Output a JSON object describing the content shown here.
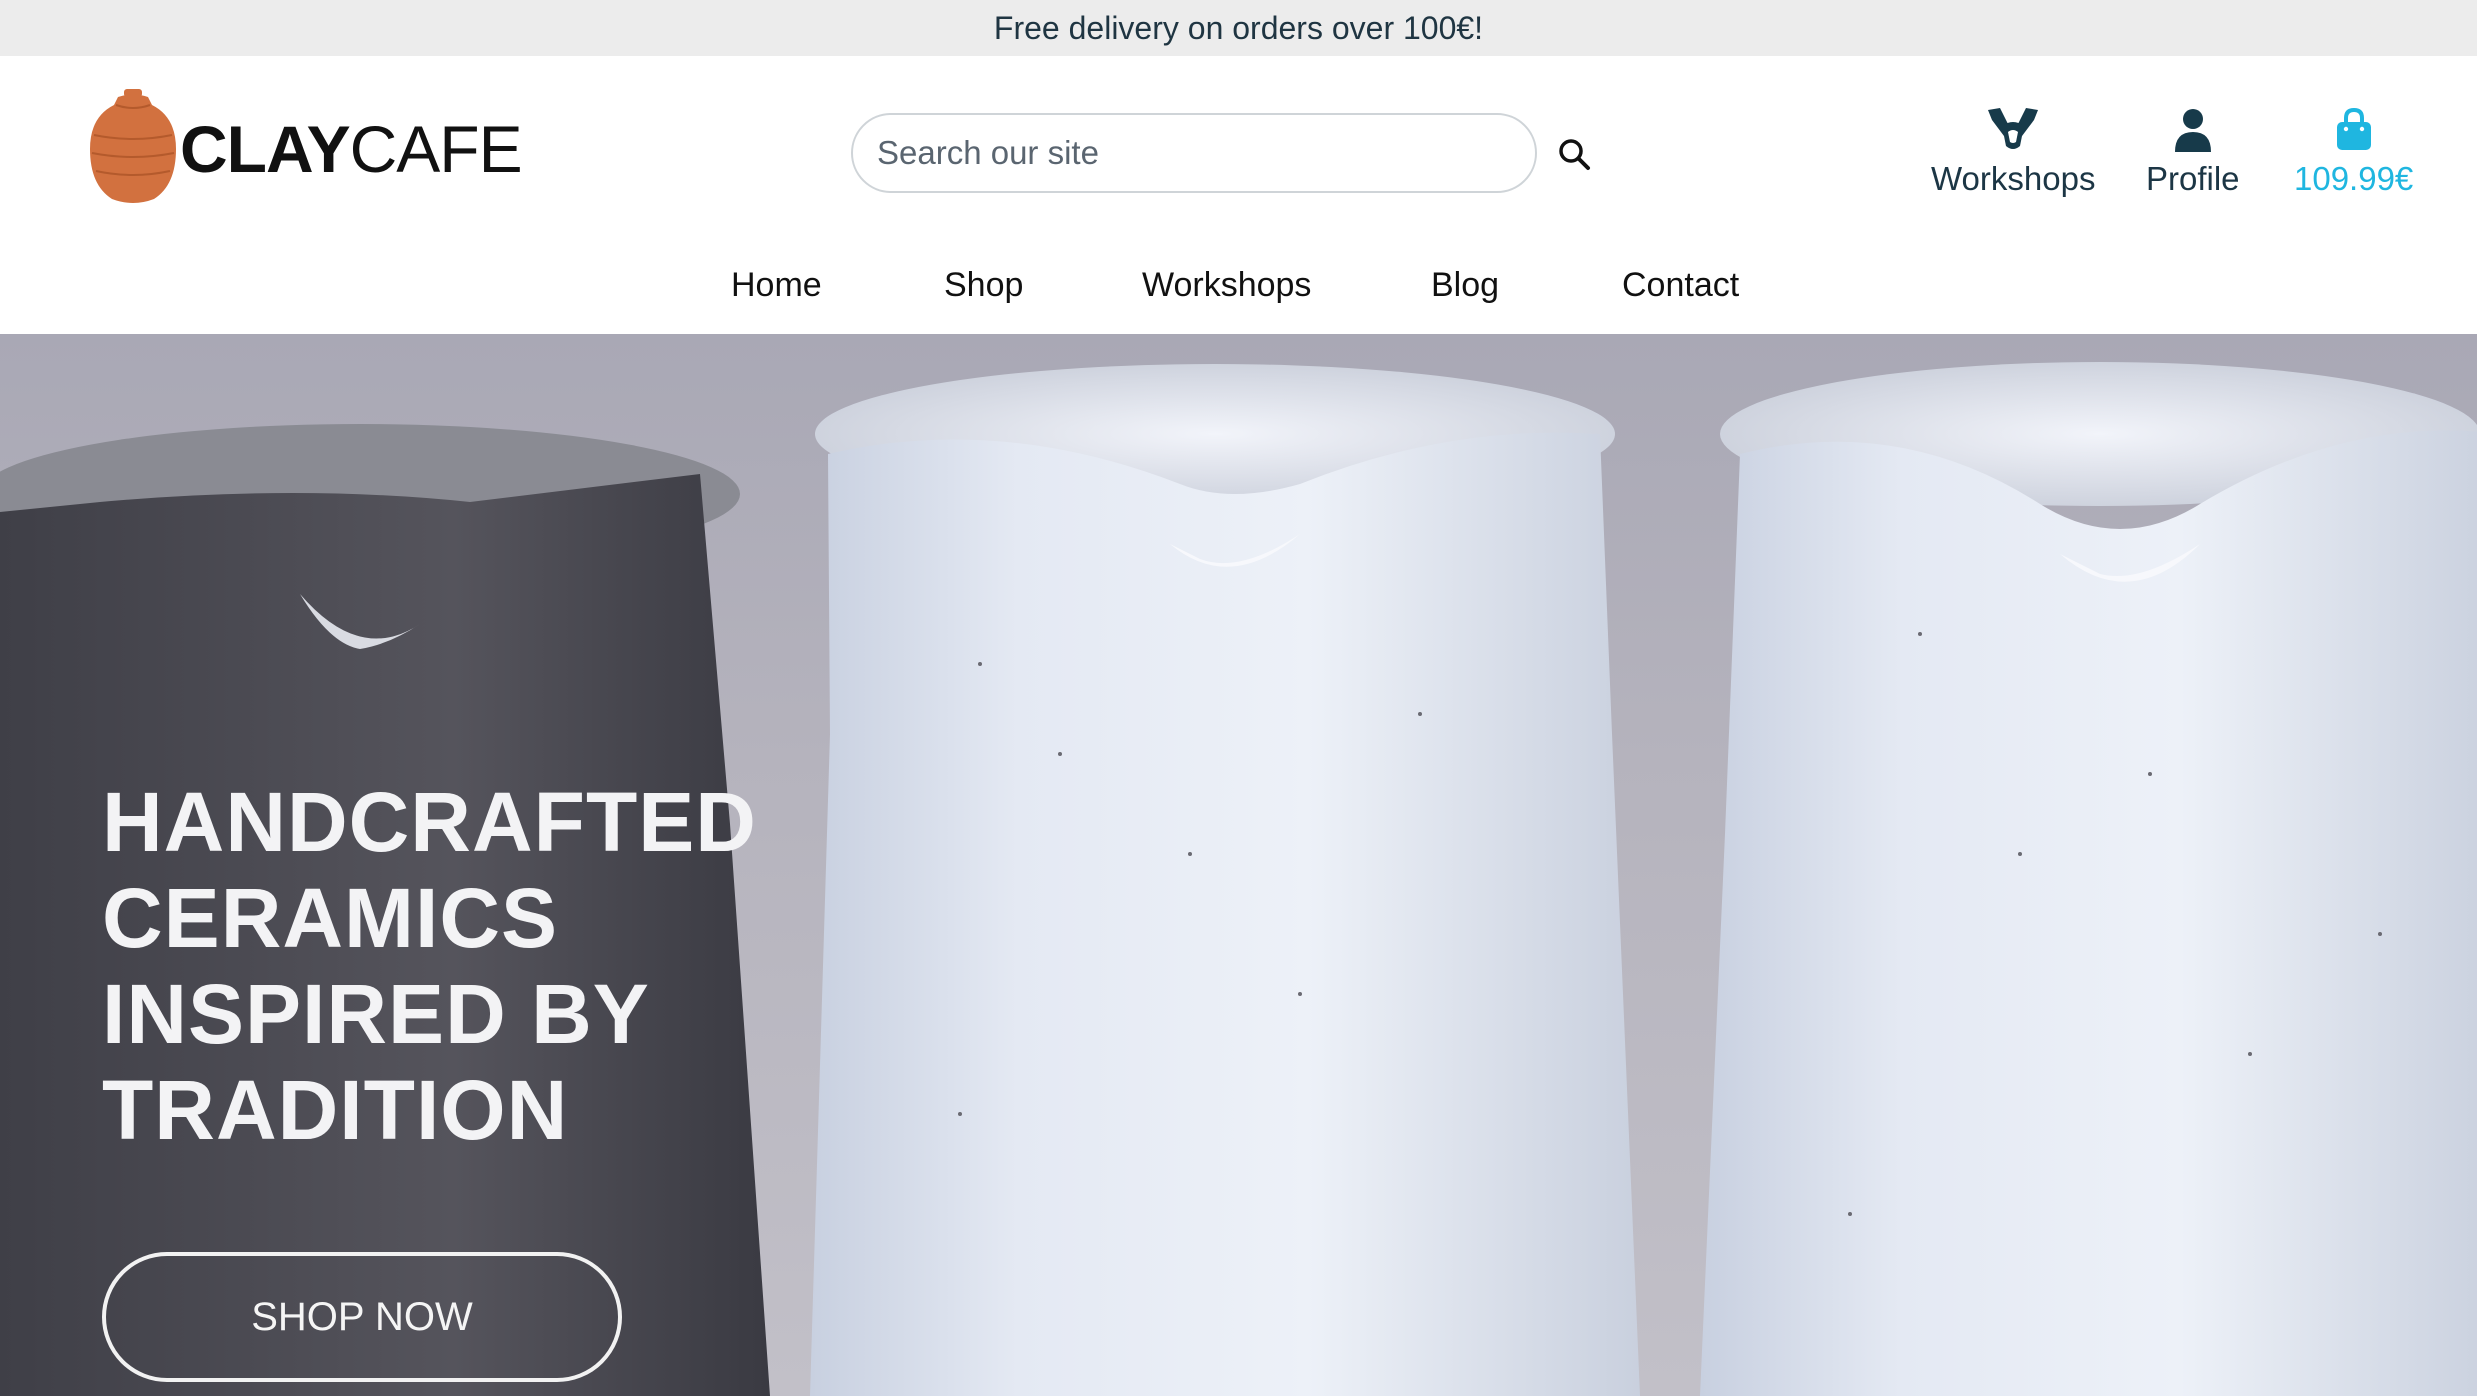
{
  "promo": {
    "text": "Free delivery on orders over 100€!"
  },
  "logo": {
    "part1": "CLAY",
    "part2": "CAFE",
    "icon": "clay-pot-icon",
    "icon_color": "#d2713f"
  },
  "search": {
    "placeholder": "Search our site",
    "value": "",
    "icon": "search-icon"
  },
  "actions": {
    "workshops": {
      "label": "Workshops",
      "icon": "hands-icon"
    },
    "profile": {
      "label": "Profile",
      "icon": "user-icon"
    },
    "cart": {
      "label": "109.99€",
      "icon": "shopping-bag-icon",
      "color": "#1fb6e0"
    }
  },
  "nav": [
    "Home",
    "Shop",
    "Workshops",
    "Blog",
    "Contact"
  ],
  "hero": {
    "title_lines": [
      "HANDCRAFTED",
      "CERAMICS",
      "INSPIRED BY",
      "TRADITION"
    ],
    "cta": "SHOP NOW"
  },
  "colors": {
    "brand_dark": "#173a4a",
    "accent": "#1fb6e0",
    "logo": "#d2713f"
  }
}
